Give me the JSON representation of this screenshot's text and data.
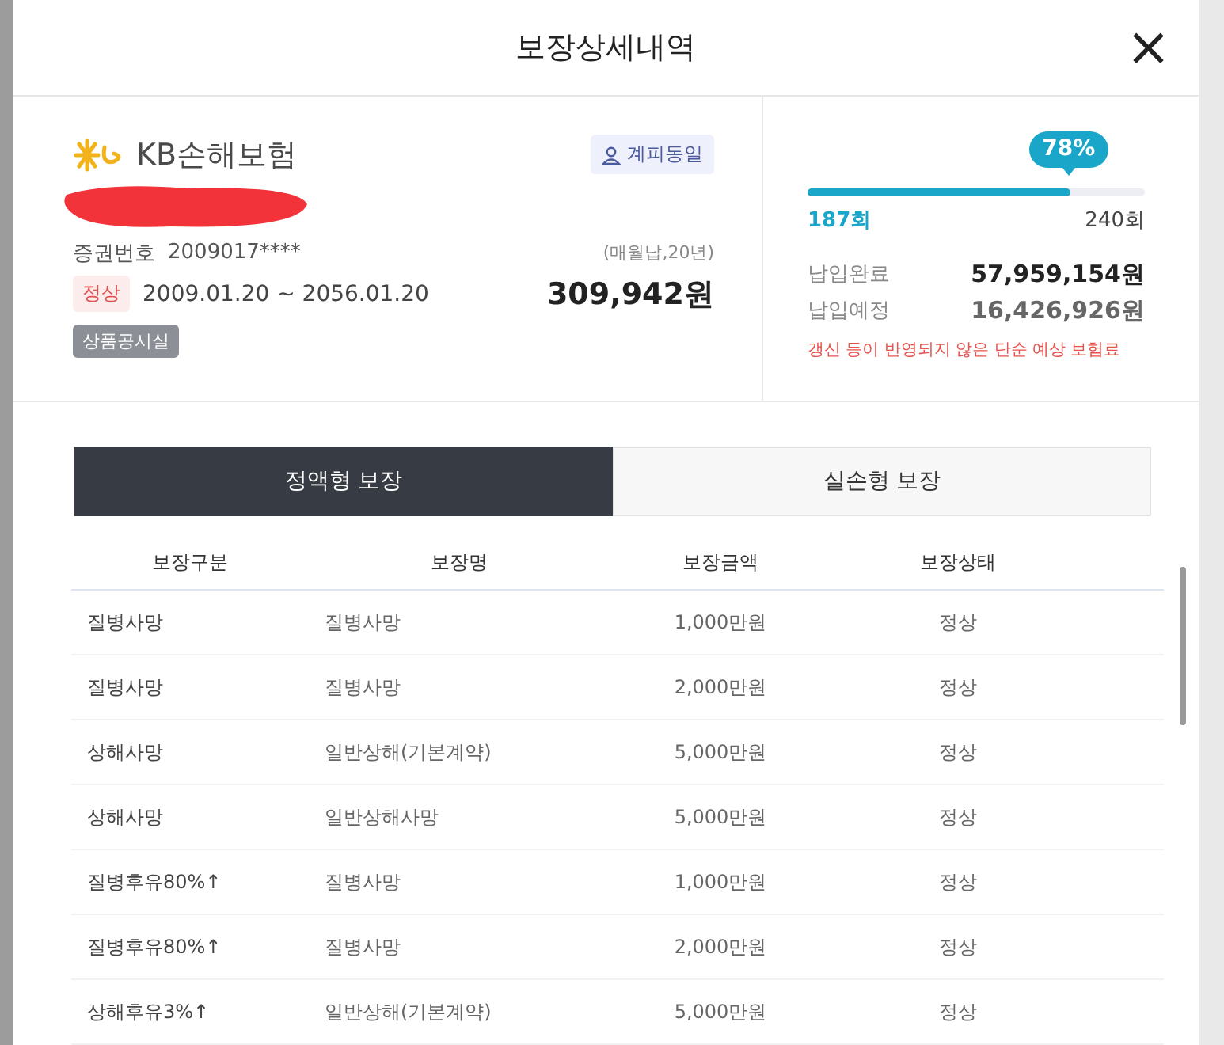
{
  "modal": {
    "title": "보장상세내역",
    "close_label": "×"
  },
  "policy": {
    "company": "KB손해보험",
    "badge": "계피동일",
    "cert_label": "증권번호",
    "cert_number": "2009017****",
    "status": "정상",
    "period": "2009.01.20 ~ 2056.01.20",
    "disclosure": "상품공시실",
    "payment_terms": "(매월납,20년)",
    "premium": "309,942원"
  },
  "payment": {
    "percent": "78%",
    "level": 0.78,
    "paid_count": "187회",
    "total_count": "240회",
    "paid_label": "납입완료",
    "paid_amount": "57,959,154원",
    "due_label": "납입예정",
    "due_amount": "16,426,926원",
    "notice": "갱신 등이 반영되지 않은 단순 예상 보험료"
  },
  "tabs": [
    {
      "label": "정액형 보장",
      "selected": true
    },
    {
      "label": "실손형 보장",
      "selected": false
    }
  ],
  "table": {
    "columns": [
      "보장구분",
      "보장명",
      "보장금액",
      "보장상태"
    ],
    "rows": [
      [
        "질병사망",
        "질병사망",
        "1,000만원",
        "정상"
      ],
      [
        "질병사망",
        "질병사망",
        "2,000만원",
        "정상"
      ],
      [
        "상해사망",
        "일반상해(기본계약)",
        "5,000만원",
        "정상"
      ],
      [
        "상해사망",
        "일반상해사망",
        "5,000만원",
        "정상"
      ],
      [
        "질병후유80%↑",
        "질병사망",
        "1,000만원",
        "정상"
      ],
      [
        "질병후유80%↑",
        "질병사망",
        "2,000만원",
        "정상"
      ],
      [
        "상해후유3%↑",
        "일반상해(기본계약)",
        "5,000만원",
        "정상"
      ]
    ]
  }
}
